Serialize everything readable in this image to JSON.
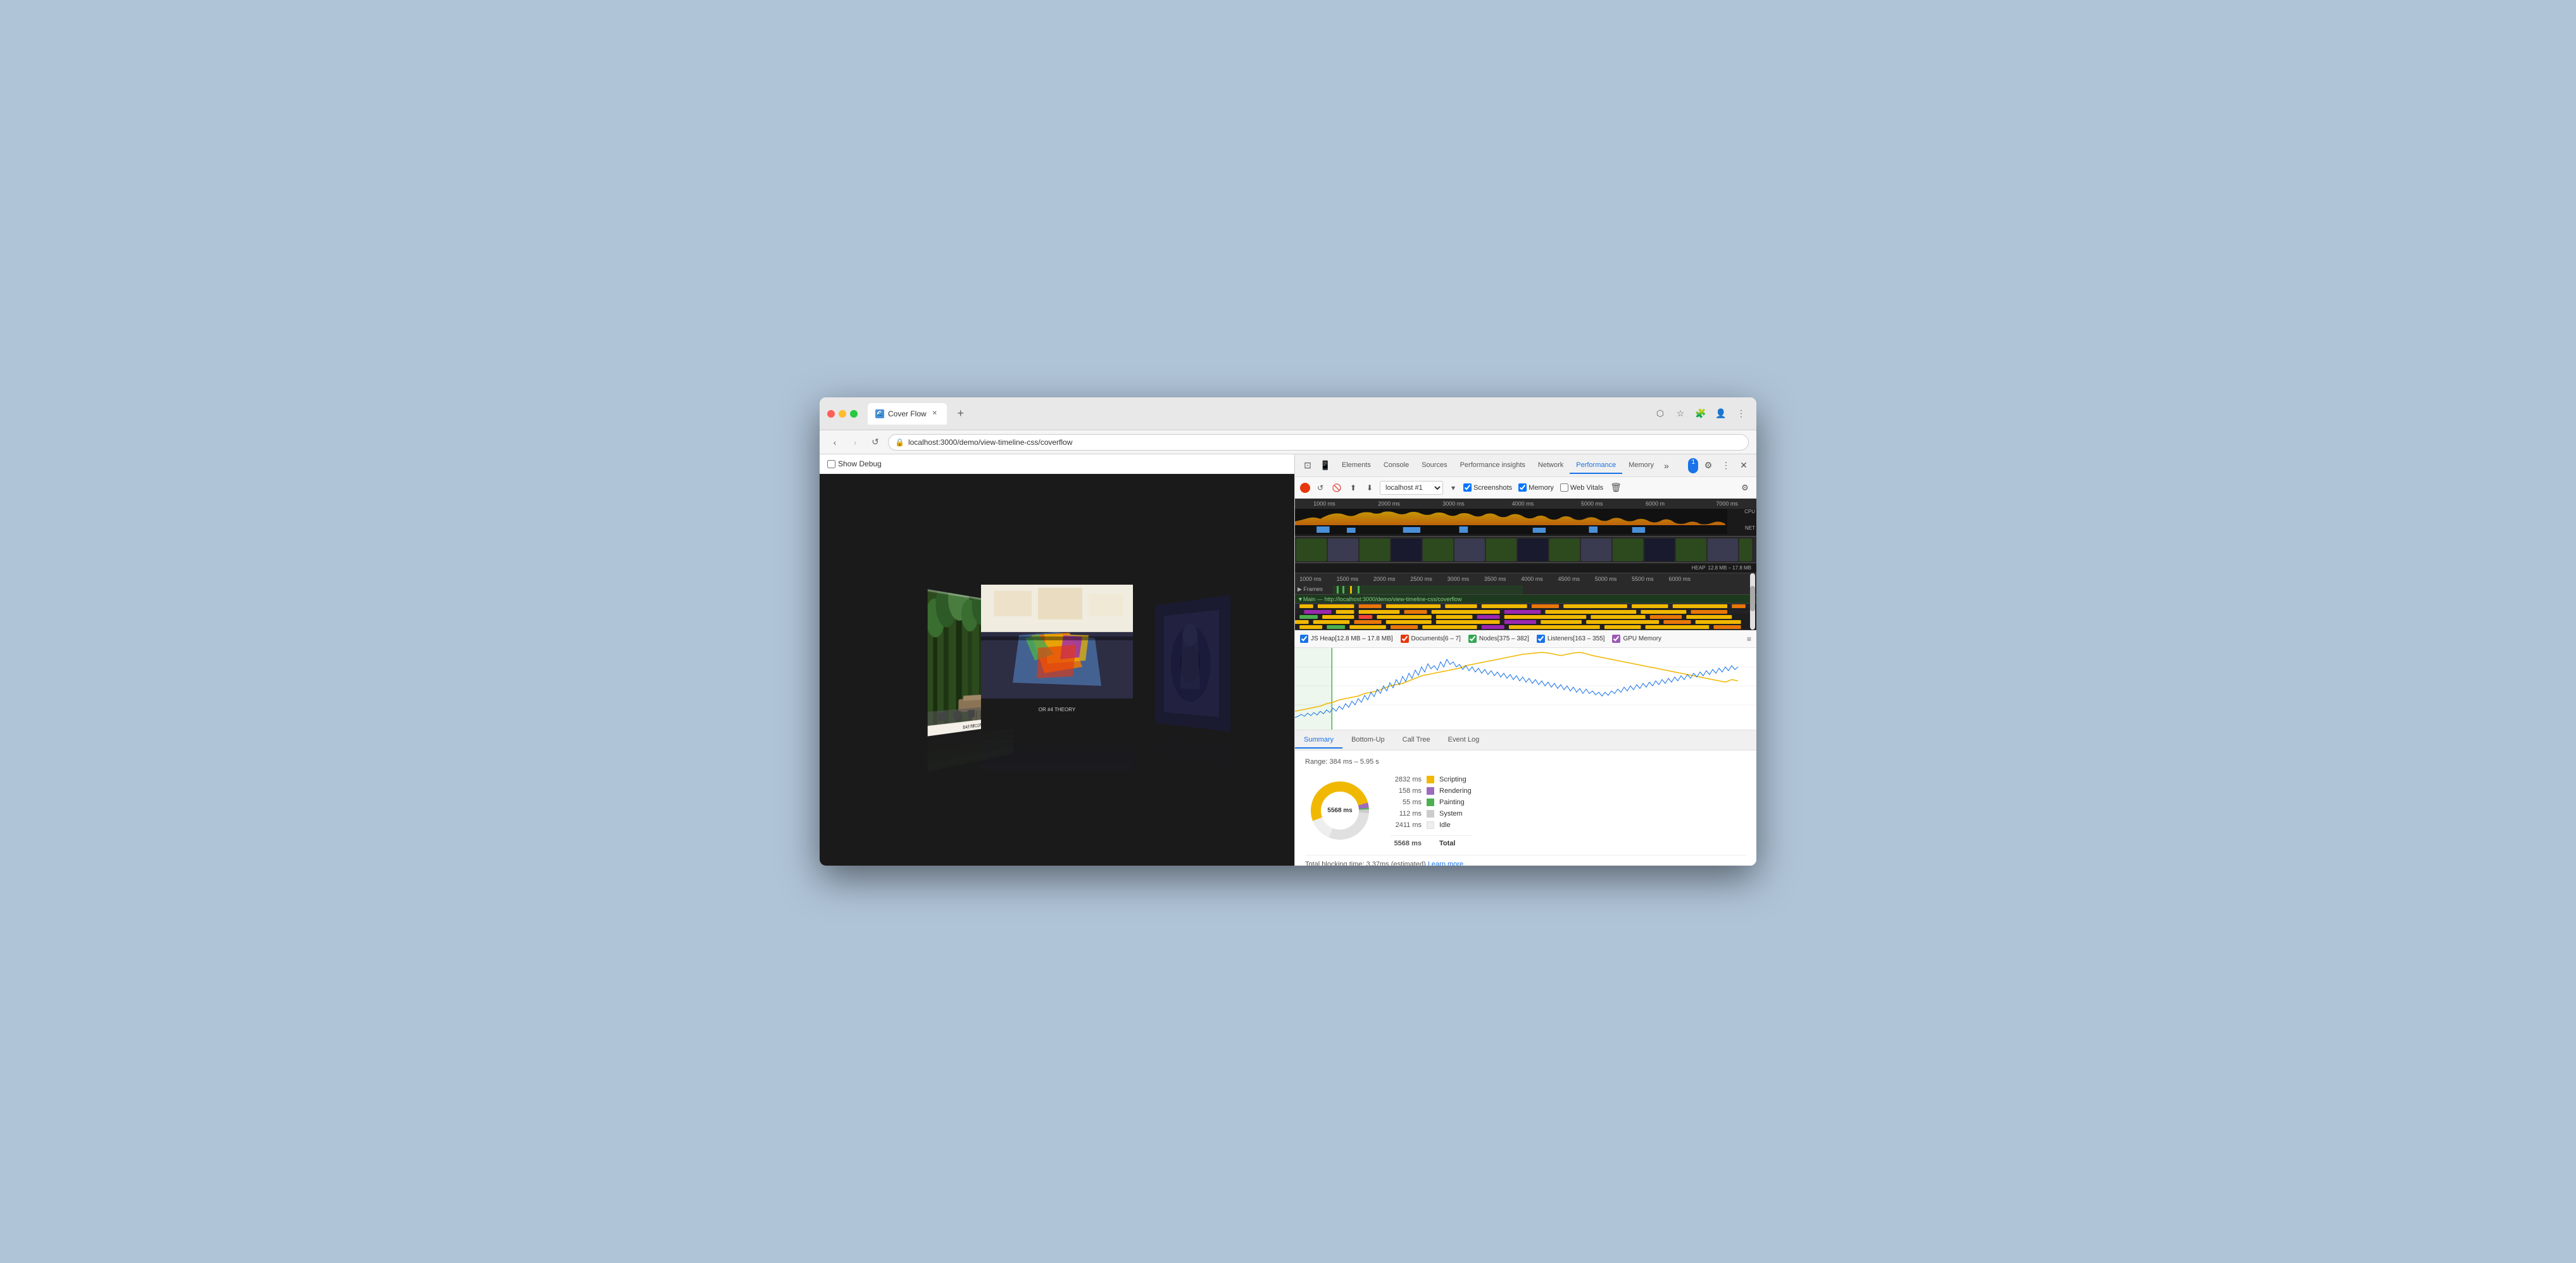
{
  "browser": {
    "tab_title": "Cover Flow",
    "tab_favicon": "🌊",
    "address": "localhost:3000/demo/view-timeline-css/coverflow",
    "address_full": "localhost:3000/demo/view-timeline-css/coverflow"
  },
  "page": {
    "title": "Cover Flow",
    "show_debug_label": "Show Debug",
    "checkbox_checked": false
  },
  "devtools": {
    "tabs": [
      "Elements",
      "Console",
      "Sources",
      "Performance insights",
      "Network",
      "Performance",
      "Memory"
    ],
    "active_tab": "Performance",
    "badge_count": "1",
    "more_tabs_label": "»"
  },
  "perf_toolbar": {
    "profile_name": "localhost #1",
    "screenshots_label": "Screenshots",
    "memory_label": "Memory",
    "web_vitals_label": "Web Vitals"
  },
  "timeline": {
    "ruler_marks": [
      "1000 ms",
      "2000 ms",
      "3000 ms",
      "4000 ms",
      "5000 ms",
      "6000 m",
      "7000 ms"
    ],
    "ruler_marks2": [
      "1000 ms",
      "1500 ms",
      "2000 ms",
      "2500 ms",
      "3000 ms",
      "3500 ms",
      "4000 ms",
      "4500 ms",
      "5000 ms",
      "5500 ms",
      "6000 ms"
    ],
    "cpu_label": "CPU",
    "net_label": "NET",
    "heap_label": "HEAP",
    "heap_range": "12.8 MB – 17.8 MB",
    "main_section": "Main — http://localhost:3000/demo/view-timeline-css/coverflow"
  },
  "memory": {
    "legend_items": [
      {
        "label": "JS Heap[12.8 MB – 17.8 MB]",
        "color": "#1a73e8",
        "checked": true
      },
      {
        "label": "Documents[6 – 7]",
        "color": "#e8360c",
        "checked": true
      },
      {
        "label": "Nodes[375 – 382]",
        "color": "#33a853",
        "checked": true
      },
      {
        "label": "Listeners[163 – 355]",
        "color": "#1a73e8",
        "checked": true
      },
      {
        "label": "GPU Memory",
        "color": "#9b59b6",
        "checked": true
      }
    ]
  },
  "bottom_tabs": {
    "items": [
      "Summary",
      "Bottom-Up",
      "Call Tree",
      "Event Log"
    ],
    "active": "Summary"
  },
  "summary": {
    "range": "Range: 384 ms – 5.95 s",
    "center_value": "5568 ms",
    "items": [
      {
        "ms": "2832 ms",
        "label": "Scripting",
        "color": "#f0b800"
      },
      {
        "ms": "158 ms",
        "label": "Rendering",
        "color": "#9c6bbd"
      },
      {
        "ms": "55 ms",
        "label": "Painting",
        "color": "#4caf50"
      },
      {
        "ms": "112 ms",
        "label": "System",
        "color": "#cccccc"
      },
      {
        "ms": "2411 ms",
        "label": "Idle",
        "color": "#eeeeee"
      }
    ],
    "total_ms": "5568 ms",
    "total_label": "Total",
    "blocking_text": "Total blocking time: 3.37ms (estimated)",
    "learn_more": "Learn more"
  }
}
